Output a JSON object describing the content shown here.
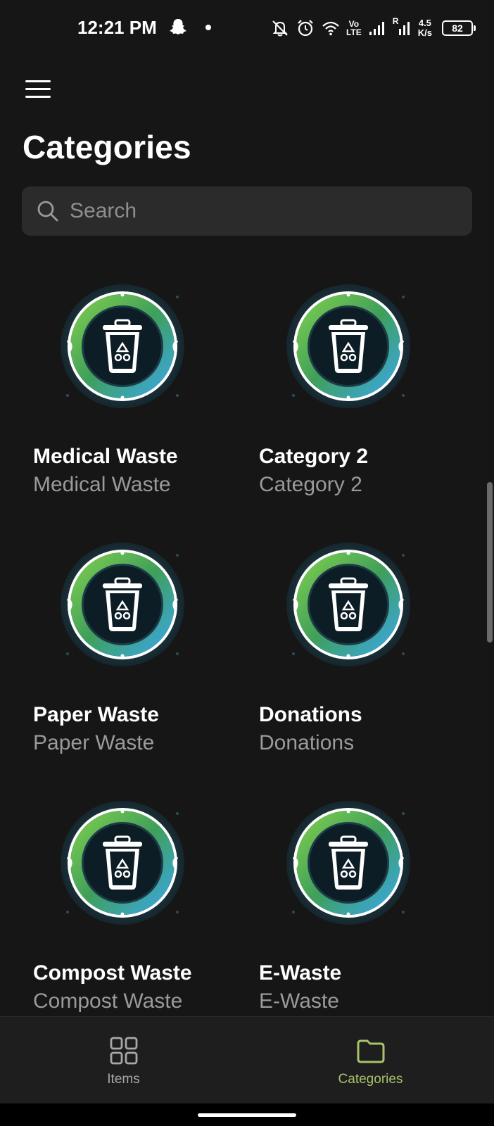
{
  "status_bar": {
    "time": "12:21 PM",
    "network_vo": "Vo",
    "network_lte": "LTE",
    "roaming": "R",
    "speed_value": "4.5",
    "speed_unit": "K/s",
    "battery": "82",
    "icons": [
      "snapchat-icon",
      "bell-off-icon",
      "alarm-icon",
      "wifi-icon",
      "signal-icon",
      "signal-icon",
      "battery-icon"
    ]
  },
  "header": {
    "menu_icon": "hamburger-menu-icon",
    "title": "Categories"
  },
  "search": {
    "placeholder": "Search",
    "value": "",
    "icon": "search-icon"
  },
  "categories": [
    {
      "title": "Medical Waste",
      "subtitle": "Medical Waste",
      "icon": "recycle-bin-badge"
    },
    {
      "title": "Category 2",
      "subtitle": "Category 2",
      "icon": "recycle-bin-badge"
    },
    {
      "title": "Paper Waste",
      "subtitle": "Paper Waste",
      "icon": "recycle-bin-badge"
    },
    {
      "title": "Donations",
      "subtitle": "Donations",
      "icon": "recycle-bin-badge"
    },
    {
      "title": "Compost Waste",
      "subtitle": "Compost Waste",
      "icon": "recycle-bin-badge"
    },
    {
      "title": "E-Waste",
      "subtitle": "E-Waste",
      "icon": "recycle-bin-badge"
    }
  ],
  "bottom_nav": {
    "items": [
      {
        "label": "Items",
        "icon": "grid-icon",
        "active": false
      },
      {
        "label": "Categories",
        "icon": "folder-icon",
        "active": true
      }
    ]
  },
  "colors": {
    "background": "#161616",
    "search_background": "#2b2b2b",
    "active_nav": "#a7c36a",
    "badge_green": "#5cb84a",
    "badge_blue": "#3aa0dc"
  }
}
